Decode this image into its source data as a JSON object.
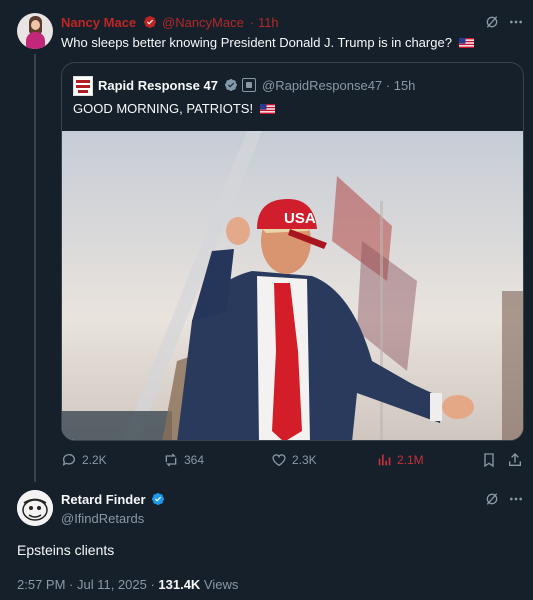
{
  "main_tweet": {
    "author_name": "Nancy Mace",
    "handle": "@NancyMace",
    "time": "· 11h",
    "text": "Who sleeps better knowing President Donald J. Trump is in charge?"
  },
  "quoted_tweet": {
    "author_name": "Rapid Response 47",
    "handle": "@RapidResponse47 · 15h",
    "text": "GOOD MORNING, PATRIOTS!",
    "photo_alt": "Donald Trump in a red USA cap dancing with fists raised in front of American flags",
    "hat_text": "USA"
  },
  "actions": {
    "replies": "2.2K",
    "reposts": "364",
    "likes": "2.3K",
    "views": "2.1M"
  },
  "reply": {
    "author_name": "Retard Finder",
    "handle": "@IfindRetards",
    "text": "Epsteins clients",
    "meta_time": "2:57 PM · Jul 11, 2025 · ",
    "meta_views_count": "131.4K",
    "meta_views_label": " Views"
  },
  "colors": {
    "background": "#15202b",
    "verified_red": "#c02525",
    "verified_blue": "#1d9bf0",
    "muted": "#8b98a5",
    "views_red": "#c5303b"
  },
  "icons": [
    "verified-badge-icon",
    "grok-icon",
    "more-icon",
    "reply-icon",
    "repost-icon",
    "like-icon",
    "views-icon",
    "bookmark-icon",
    "share-icon",
    "flag-us-icon",
    "government-badge-icon"
  ]
}
